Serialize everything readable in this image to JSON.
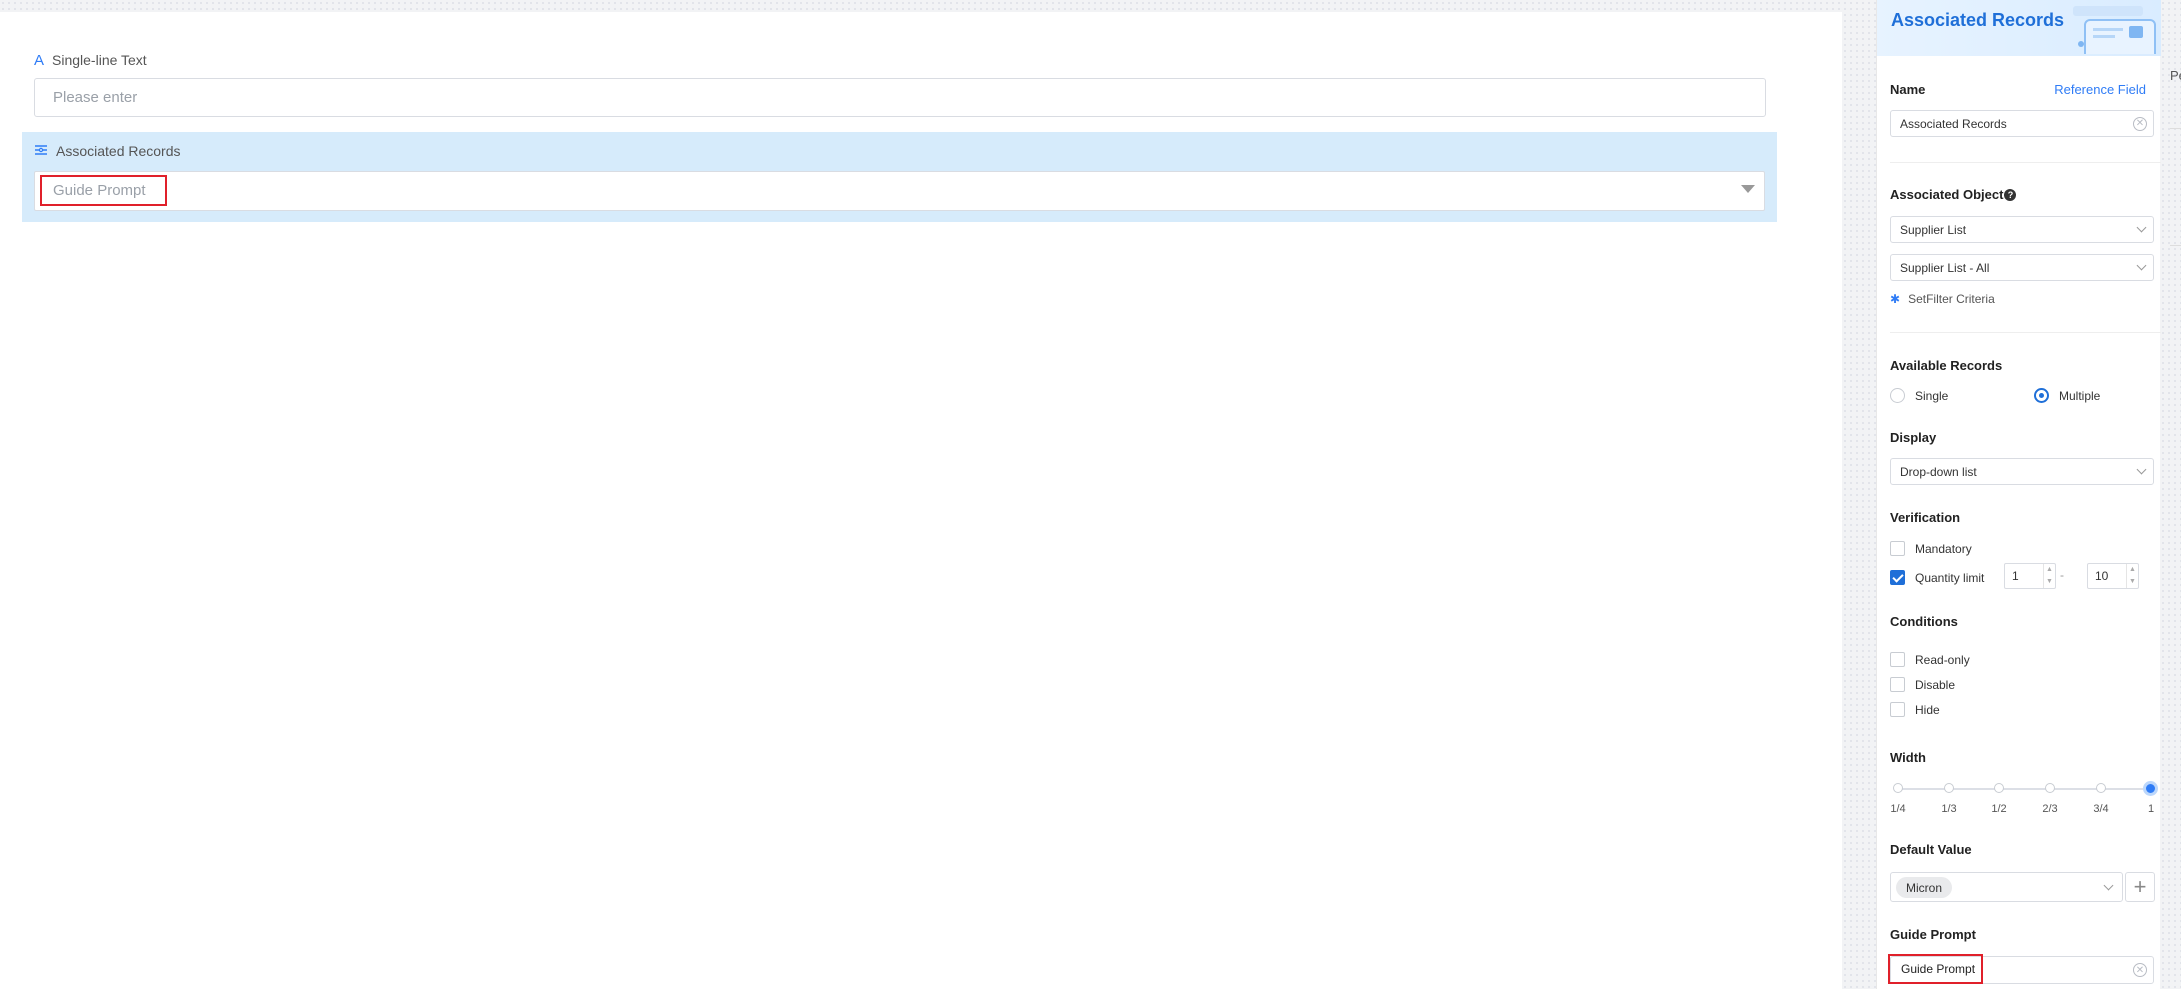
{
  "canvas": {
    "single_line": {
      "label": "Single-line Text",
      "icon": "A",
      "placeholder": "Please enter"
    },
    "associated": {
      "label": "Associated Records",
      "placeholder": "Guide Prompt"
    }
  },
  "panel": {
    "title": "Associated Records",
    "name": {
      "label": "Name",
      "link": "Reference Field",
      "value": "Associated Records"
    },
    "associated_object": {
      "label": "Associated Object",
      "object_value": "Supplier List",
      "view_value": "Supplier List - All",
      "filter_link": "SetFilter Criteria"
    },
    "available_records": {
      "label": "Available Records",
      "option_single": "Single",
      "option_multiple": "Multiple",
      "selected": "Multiple"
    },
    "display": {
      "label": "Display",
      "value": "Drop-down list"
    },
    "verification": {
      "label": "Verification",
      "mandatory": "Mandatory",
      "quantity_limit": "Quantity limit",
      "min": "1",
      "separator": "-",
      "max": "10"
    },
    "conditions": {
      "label": "Conditions",
      "read_only": "Read-only",
      "disable": "Disable",
      "hide": "Hide"
    },
    "width": {
      "label": "Width",
      "ticks": [
        "1/4",
        "1/3",
        "1/2",
        "2/3",
        "3/4",
        "1"
      ],
      "selected": "1"
    },
    "default_value": {
      "label": "Default Value",
      "tag": "Micron"
    },
    "guide_prompt": {
      "label": "Guide Prompt",
      "value": "Guide Prompt"
    }
  },
  "edge_text": "Pe",
  "colors": {
    "accent": "#2f7cf6",
    "highlight": "#d6ebfb",
    "annotation": "#e0202a"
  }
}
